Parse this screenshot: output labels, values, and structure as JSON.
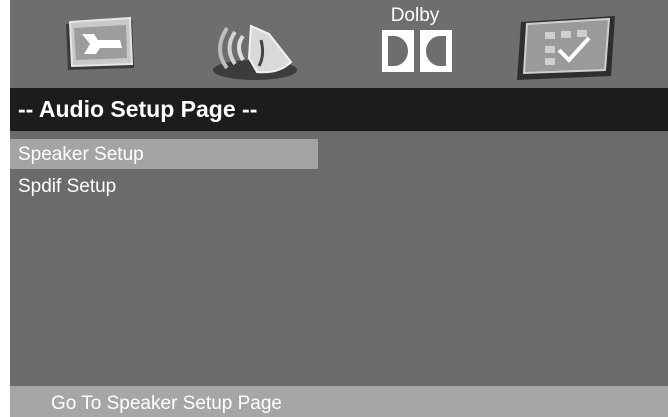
{
  "icon_bar": {
    "tabs": [
      {
        "icon": "general-setup-icon"
      },
      {
        "icon": "audio-setup-icon"
      },
      {
        "icon": "dolby-icon",
        "label": "Dolby"
      },
      {
        "icon": "preference-icon"
      }
    ],
    "active_index": 1
  },
  "title": "-- Audio Setup Page --",
  "menu": {
    "items": [
      {
        "label": "Speaker Setup"
      },
      {
        "label": "Spdif Setup"
      }
    ],
    "selected_index": 0
  },
  "status": "Go To Speaker Setup Page"
}
